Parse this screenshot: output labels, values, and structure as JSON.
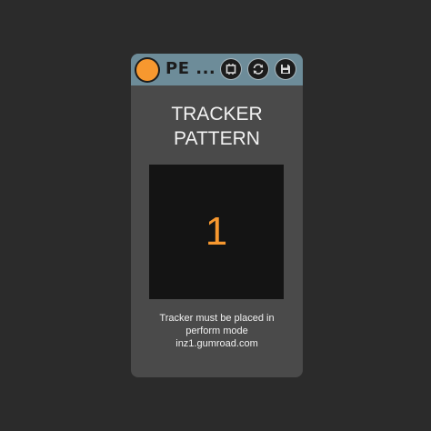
{
  "device": {
    "title": "PE ...",
    "buttons": {
      "device_icon": "device-icon",
      "refresh_icon": "refresh-icon",
      "save_icon": "save-icon"
    },
    "heading_line1": "TRACKER",
    "heading_line2": "PATTERN",
    "pattern_number": "1",
    "note_line1": "Tracker must be placed in",
    "note_line2": "perform mode",
    "note_line3": "inz1.gumroad.com"
  },
  "colors": {
    "background": "#2b2b2b",
    "panel": "#4a4a4a",
    "titlebar": "#6d8c99",
    "accent": "#f7982f",
    "screen": "#141414"
  }
}
